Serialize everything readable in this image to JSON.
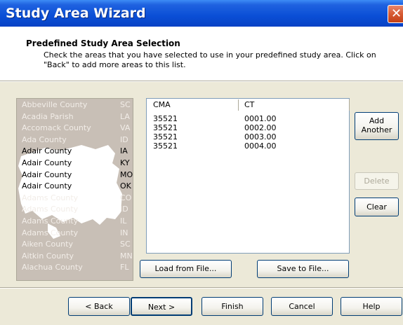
{
  "window": {
    "title": "Study Area Wizard",
    "close_glyph": "✕"
  },
  "header": {
    "title": "Predefined Study Area Selection",
    "description": "Check the areas that you have selected to use in your predefined study area.  Click on \"Back\" to add more areas to this list."
  },
  "counties": [
    {
      "name": "Abbeville County",
      "state": "SC"
    },
    {
      "name": "Acadia Parish",
      "state": "LA"
    },
    {
      "name": "Accomack County",
      "state": "VA"
    },
    {
      "name": "Ada County",
      "state": "ID"
    },
    {
      "name": "Adair County",
      "state": "IA"
    },
    {
      "name": "Adair County",
      "state": "KY"
    },
    {
      "name": "Adair County",
      "state": "MO"
    },
    {
      "name": "Adair County",
      "state": "OK"
    },
    {
      "name": "Adams County",
      "state": "CO"
    },
    {
      "name": "Adams County",
      "state": "ID"
    },
    {
      "name": "Adams County",
      "state": "IL"
    },
    {
      "name": "Adams County",
      "state": "IN"
    },
    {
      "name": "Aiken County",
      "state": "SC"
    },
    {
      "name": "Aitkin County",
      "state": "MN"
    },
    {
      "name": "Alachua County",
      "state": "FL"
    }
  ],
  "table": {
    "headers": [
      "CMA",
      "CT"
    ],
    "rows": [
      [
        "35521",
        "0001.00"
      ],
      [
        "35521",
        "0002.00"
      ],
      [
        "35521",
        "0003.00"
      ],
      [
        "35521",
        "0004.00"
      ]
    ]
  },
  "side_buttons": {
    "add_line1": "Add",
    "add_line2": "Another",
    "delete": "Delete",
    "clear": "Clear"
  },
  "file_buttons": {
    "load": "Load from File...",
    "save": "Save to File..."
  },
  "nav_buttons": {
    "back": "< Back",
    "next": "Next >",
    "finish": "Finish",
    "cancel": "Cancel",
    "help": "Help"
  }
}
